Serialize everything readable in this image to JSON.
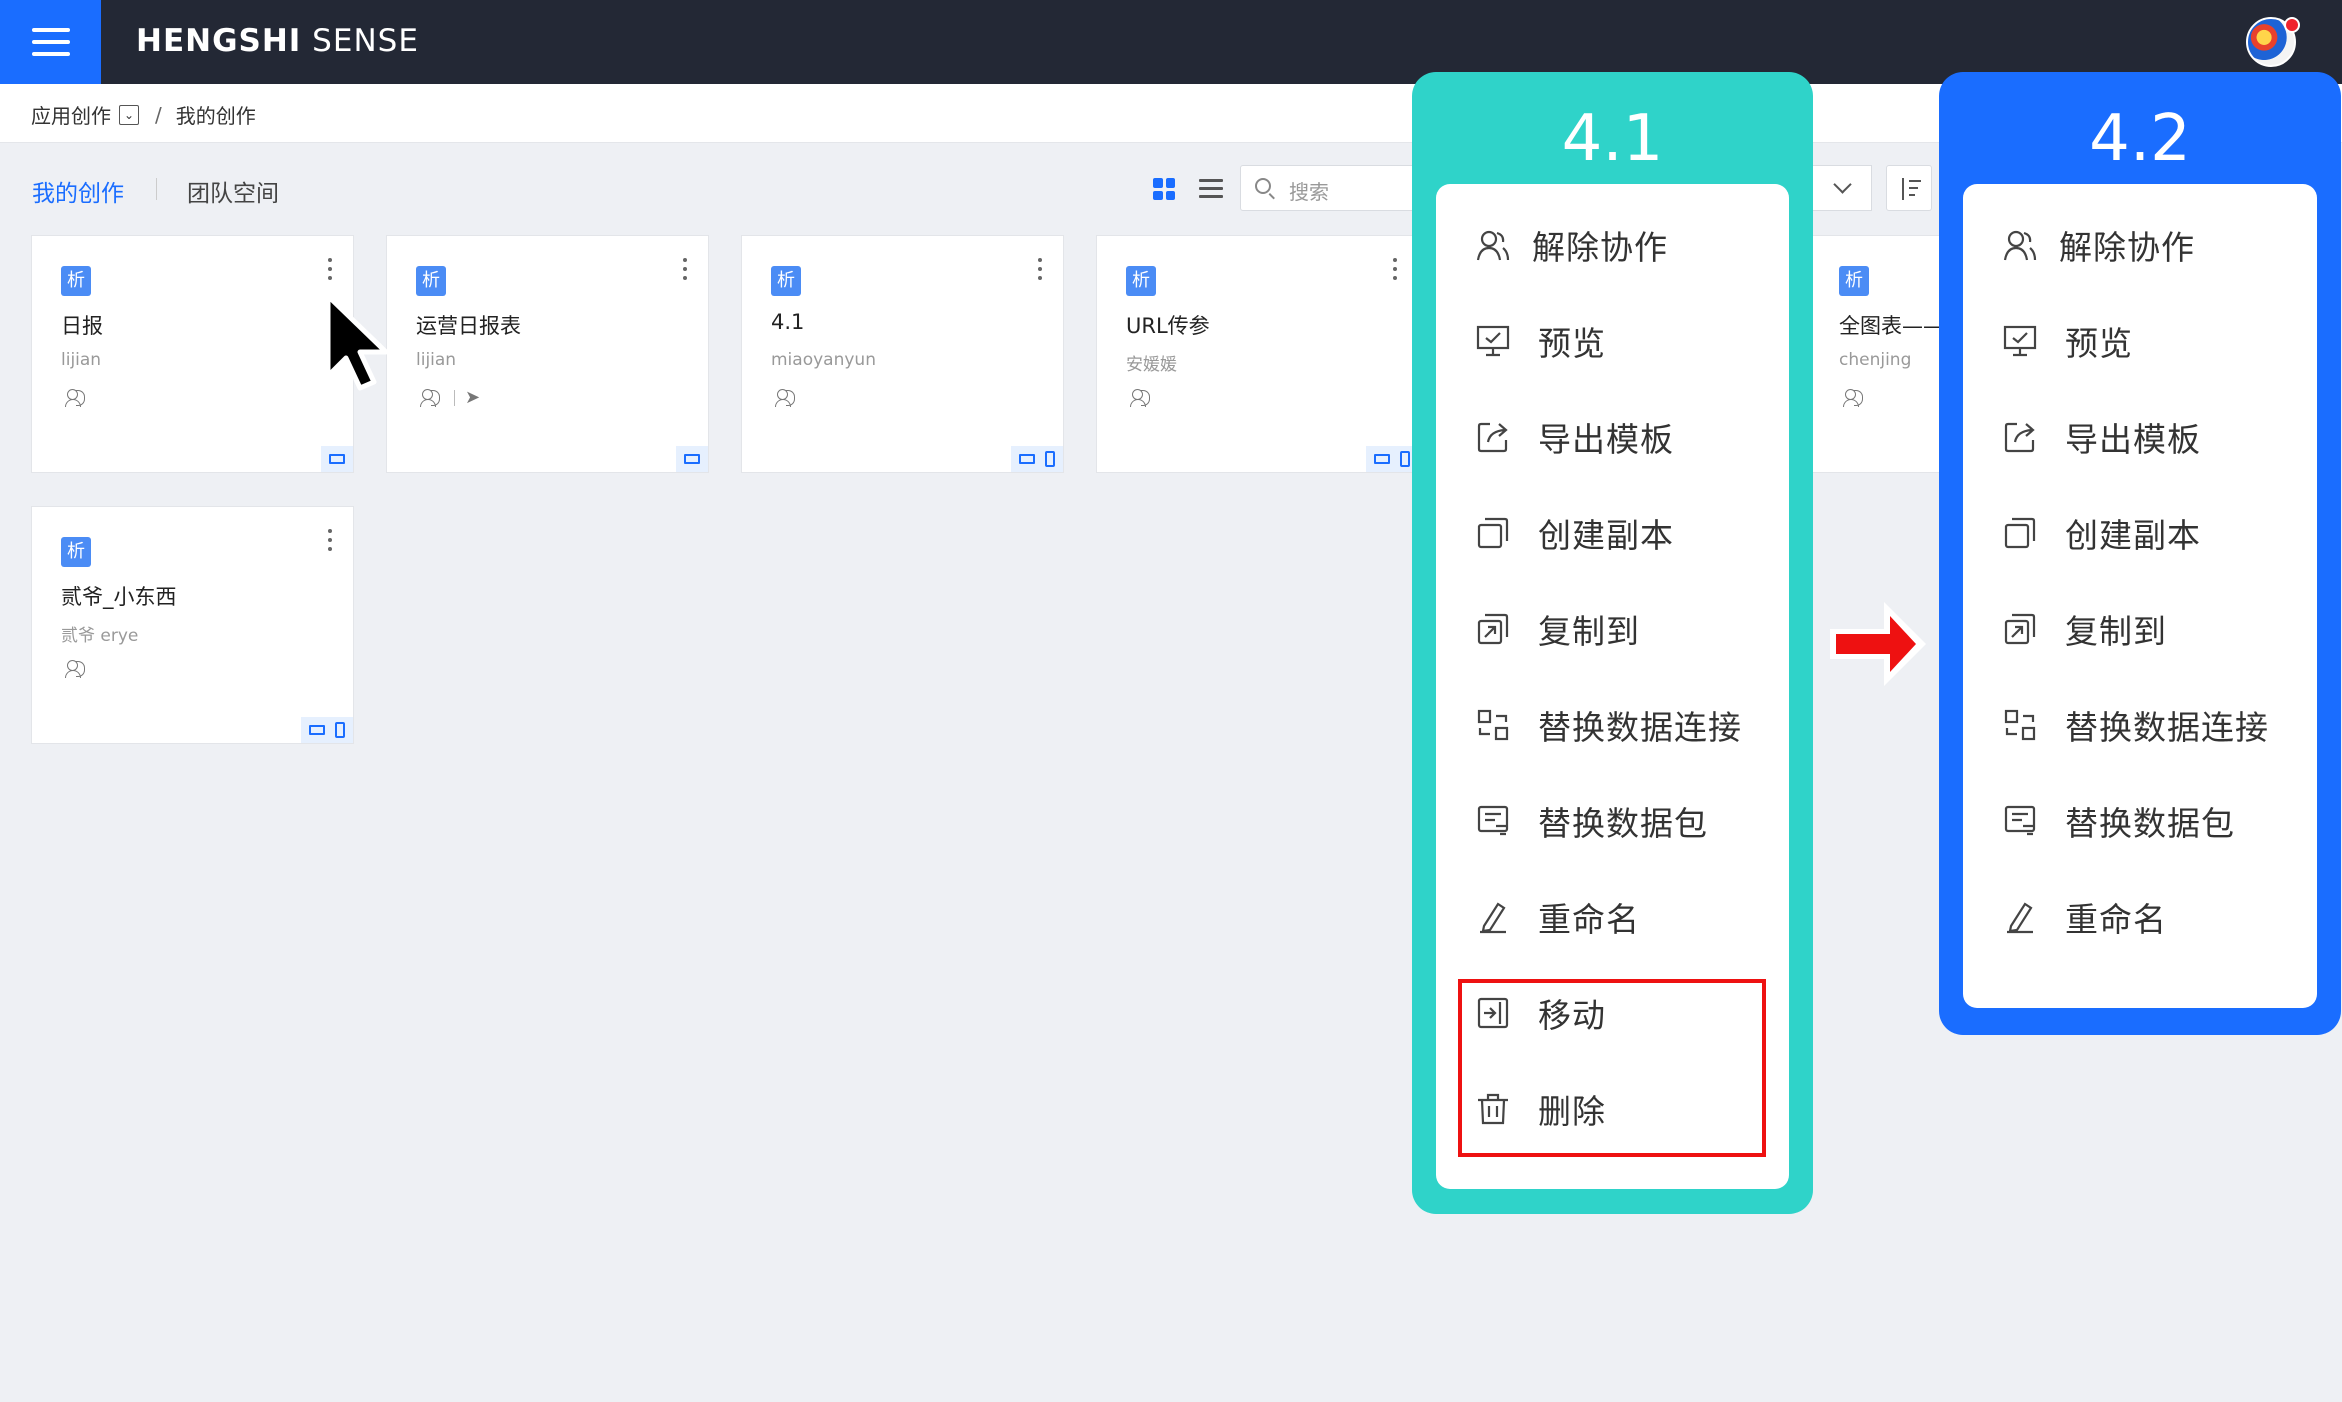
{
  "app": {
    "brand_bold": "HENGSHI",
    "brand_light": " SENSE"
  },
  "breadcrumb": {
    "root": "应用创作",
    "separator": "/",
    "current": "我的创作"
  },
  "tabs": {
    "mine": "我的创作",
    "team": "团队空间"
  },
  "search": {
    "placeholder": "搜索"
  },
  "badge_label": "析",
  "cards": [
    {
      "title": "日报",
      "owner": "lijian",
      "share": false,
      "mobile": false
    },
    {
      "title": "运营日报表",
      "owner": "lijian",
      "share": true,
      "mobile": false
    },
    {
      "title": "4.1",
      "owner": "miaoyanyun",
      "share": false,
      "mobile": true
    },
    {
      "title": "URL传参",
      "owner": "安媛媛",
      "share": false,
      "mobile": true
    },
    {
      "title": "全图表——",
      "owner": "chenjing",
      "share": false,
      "mobile": false
    },
    {
      "title": "贰爷_小东西",
      "owner": "贰爷 erye",
      "share": false,
      "mobile": true
    }
  ],
  "menu_41": {
    "title": "4.1",
    "items": [
      "解除协作",
      "预览",
      "导出模板",
      "创建副本",
      "复制到",
      "替换数据连接",
      "替换数据包",
      "重命名",
      "移动",
      "删除"
    ],
    "highlighted": [
      "移动",
      "删除"
    ]
  },
  "menu_42": {
    "title": "4.2",
    "items": [
      "解除协作",
      "预览",
      "导出模板",
      "创建副本",
      "复制到",
      "替换数据连接",
      "替换数据包",
      "重命名"
    ]
  },
  "icons": {
    "menu": "hamburger-icon",
    "avatar": "user-avatar",
    "grid": "grid-view-icon",
    "list": "list-view-icon",
    "search": "search-icon",
    "sort": "sort-icon",
    "kebab": "more-vertical-icon",
    "people": "collaborators-icon",
    "share": "send-icon",
    "laptop": "desktop-icon",
    "mobile": "mobile-icon",
    "arrow": "right-arrow-icon"
  },
  "colors": {
    "accent": "#1a6dff",
    "panel_41": "#2fd3c9",
    "panel_42": "#1a6dff",
    "highlight": "#ee1111",
    "topbar": "#232835"
  }
}
